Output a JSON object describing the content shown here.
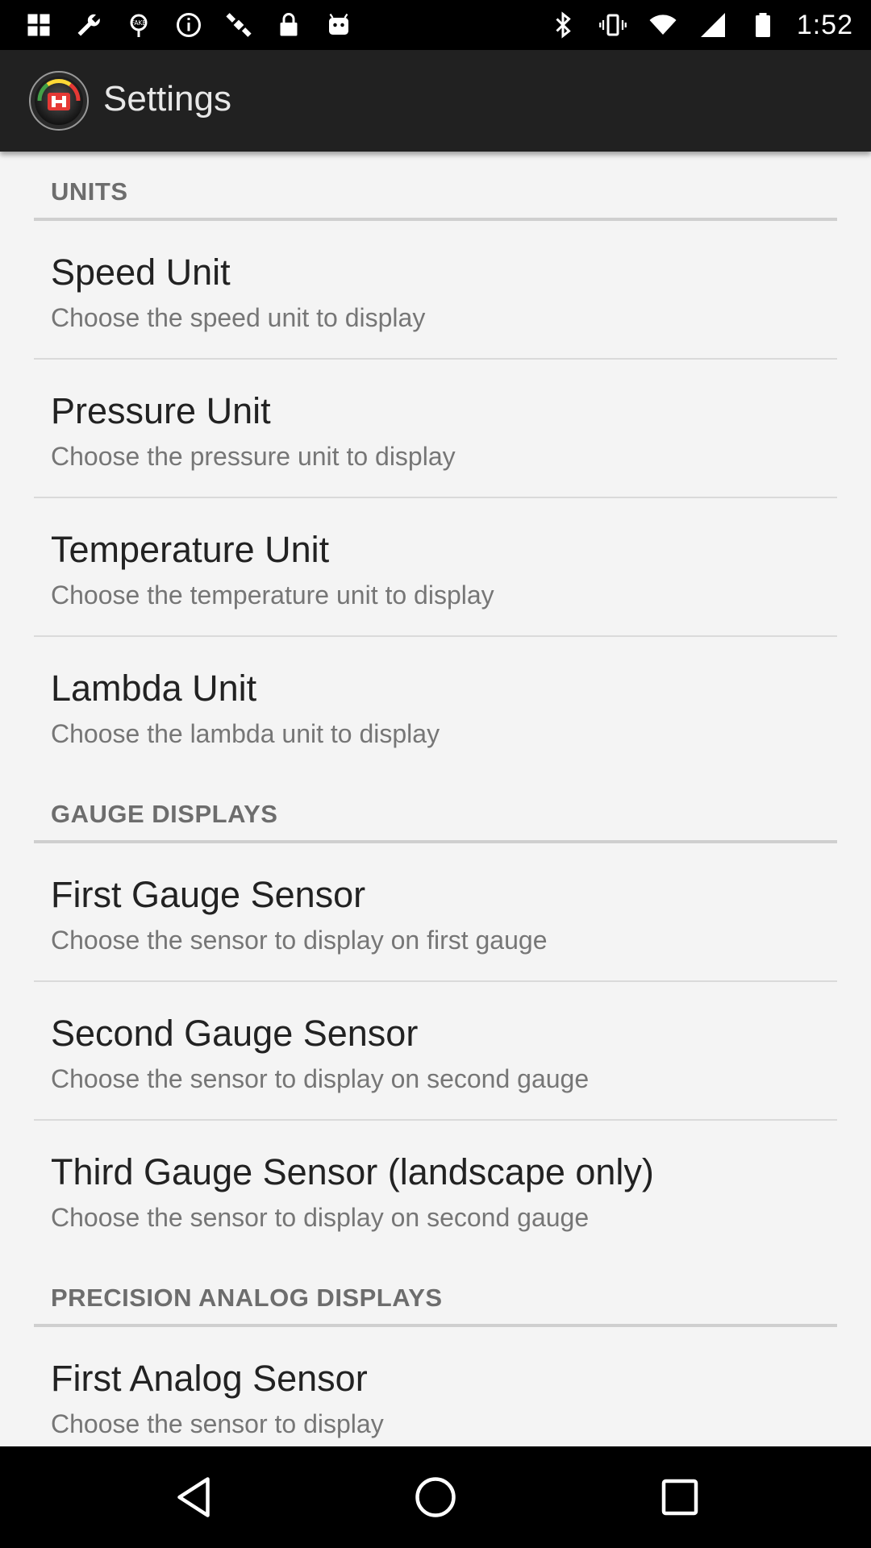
{
  "status_bar": {
    "time": "1:52",
    "left_icons": [
      "grid-icon",
      "tool-icon",
      "fake-gps-icon",
      "info-icon",
      "satellite-icon",
      "lock-icon",
      "android-icon"
    ],
    "right_icons": [
      "bluetooth-icon",
      "vibrate-icon",
      "wifi-icon",
      "signal-icon",
      "battery-icon"
    ]
  },
  "action_bar": {
    "title": "Settings",
    "app_icon": "gauge-app-icon",
    "accent_color": "#e53935"
  },
  "sections": [
    {
      "title": "UNITS",
      "items": [
        {
          "title": "Speed Unit",
          "summary": "Choose the speed unit to display"
        },
        {
          "title": "Pressure Unit",
          "summary": "Choose the pressure unit to display"
        },
        {
          "title": "Temperature Unit",
          "summary": "Choose the temperature unit to display"
        },
        {
          "title": "Lambda Unit",
          "summary": "Choose the lambda unit to display"
        }
      ]
    },
    {
      "title": "GAUGE DISPLAYS",
      "items": [
        {
          "title": "First Gauge Sensor",
          "summary": "Choose the sensor to display on first gauge"
        },
        {
          "title": "Second Gauge Sensor",
          "summary": "Choose the sensor to display on second gauge"
        },
        {
          "title": "Third Gauge Sensor (landscape only)",
          "summary": "Choose the sensor to display on second gauge"
        }
      ]
    },
    {
      "title": "PRECISION ANALOG DISPLAYS",
      "items": [
        {
          "title": "First Analog Sensor",
          "summary": "Choose the sensor to display"
        }
      ]
    }
  ],
  "nav_bar": {
    "buttons": [
      "back-icon",
      "home-icon",
      "recents-icon"
    ]
  }
}
